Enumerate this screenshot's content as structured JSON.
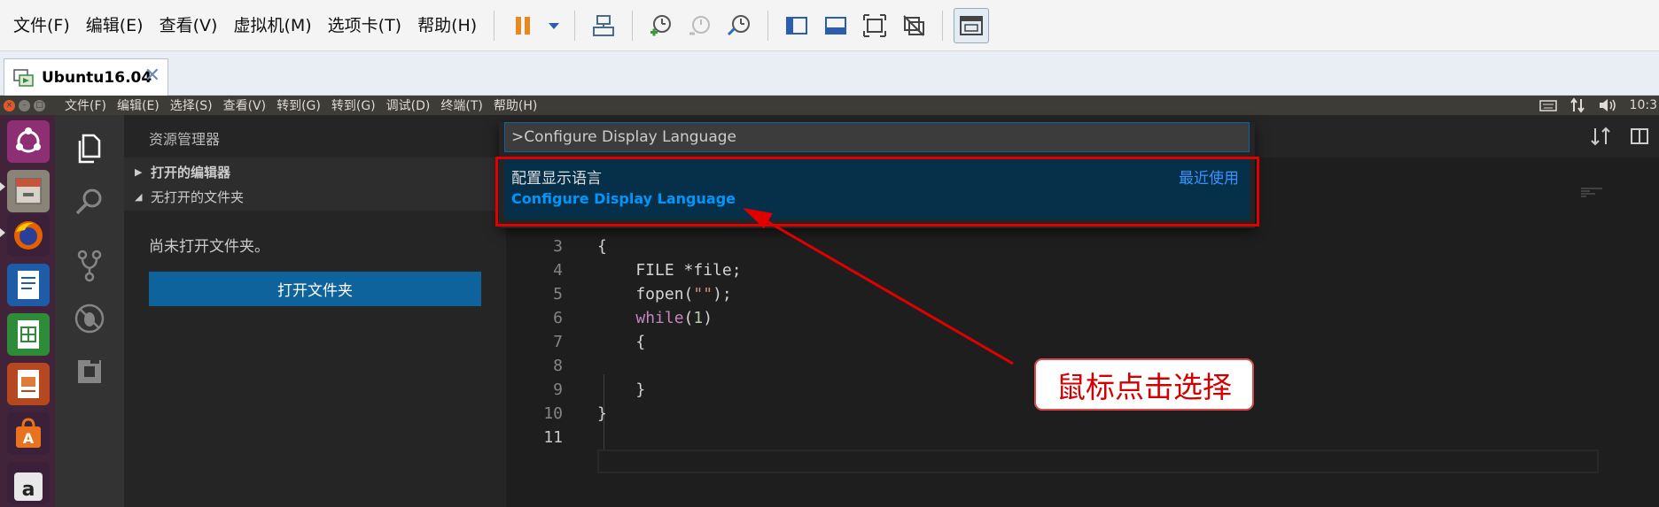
{
  "vmware": {
    "menu": [
      "文件(F)",
      "编辑(E)",
      "查看(V)",
      "虚拟机(M)",
      "选项卡(T)",
      "帮助(H)"
    ],
    "tab_label": "Ubuntu16.04",
    "tab_close": "✕"
  },
  "ubuntu": {
    "menu": [
      "文件(F)",
      "编辑(E)",
      "选择(S)",
      "查看(V)",
      "转到(G)",
      "转到(G)",
      "调试(D)",
      "终端(T)",
      "帮助(H)"
    ],
    "clock": "10:3",
    "launcher_icons": [
      "ubuntu-dash-icon",
      "files-icon",
      "firefox-icon",
      "writer-icon",
      "calc-icon",
      "impress-icon",
      "software-center-icon",
      "amazon-icon"
    ]
  },
  "vscode": {
    "sidebar": {
      "title": "资源管理器",
      "open_editors": "打开的编辑器",
      "no_folder": "无打开的文件夹",
      "message": "尚未打开文件夹。",
      "open_folder_button": "打开文件夹"
    },
    "palette": {
      "input_value": ">Configure Display Language",
      "item_title": "配置显示语言",
      "item_subtitle": "Configure Display Language",
      "item_badge": "最近使用"
    },
    "code_lines": [
      {
        "n": "3",
        "text": "{"
      },
      {
        "n": "4",
        "text": "    FILE *file;"
      },
      {
        "n": "5",
        "pre": "    fopen(",
        "str": "\"\"",
        "post": ");"
      },
      {
        "n": "6",
        "pre": "    ",
        "kw": "while",
        "mid": "(",
        "num": "1",
        "post": ")"
      },
      {
        "n": "7",
        "text": "    {"
      },
      {
        "n": "8",
        "text": ""
      },
      {
        "n": "9",
        "text": "    }"
      },
      {
        "n": "10",
        "text": "}"
      },
      {
        "n": "11",
        "text": ""
      }
    ]
  },
  "annotation": {
    "callout": "鼠标点击选择",
    "color": "#e00000"
  }
}
